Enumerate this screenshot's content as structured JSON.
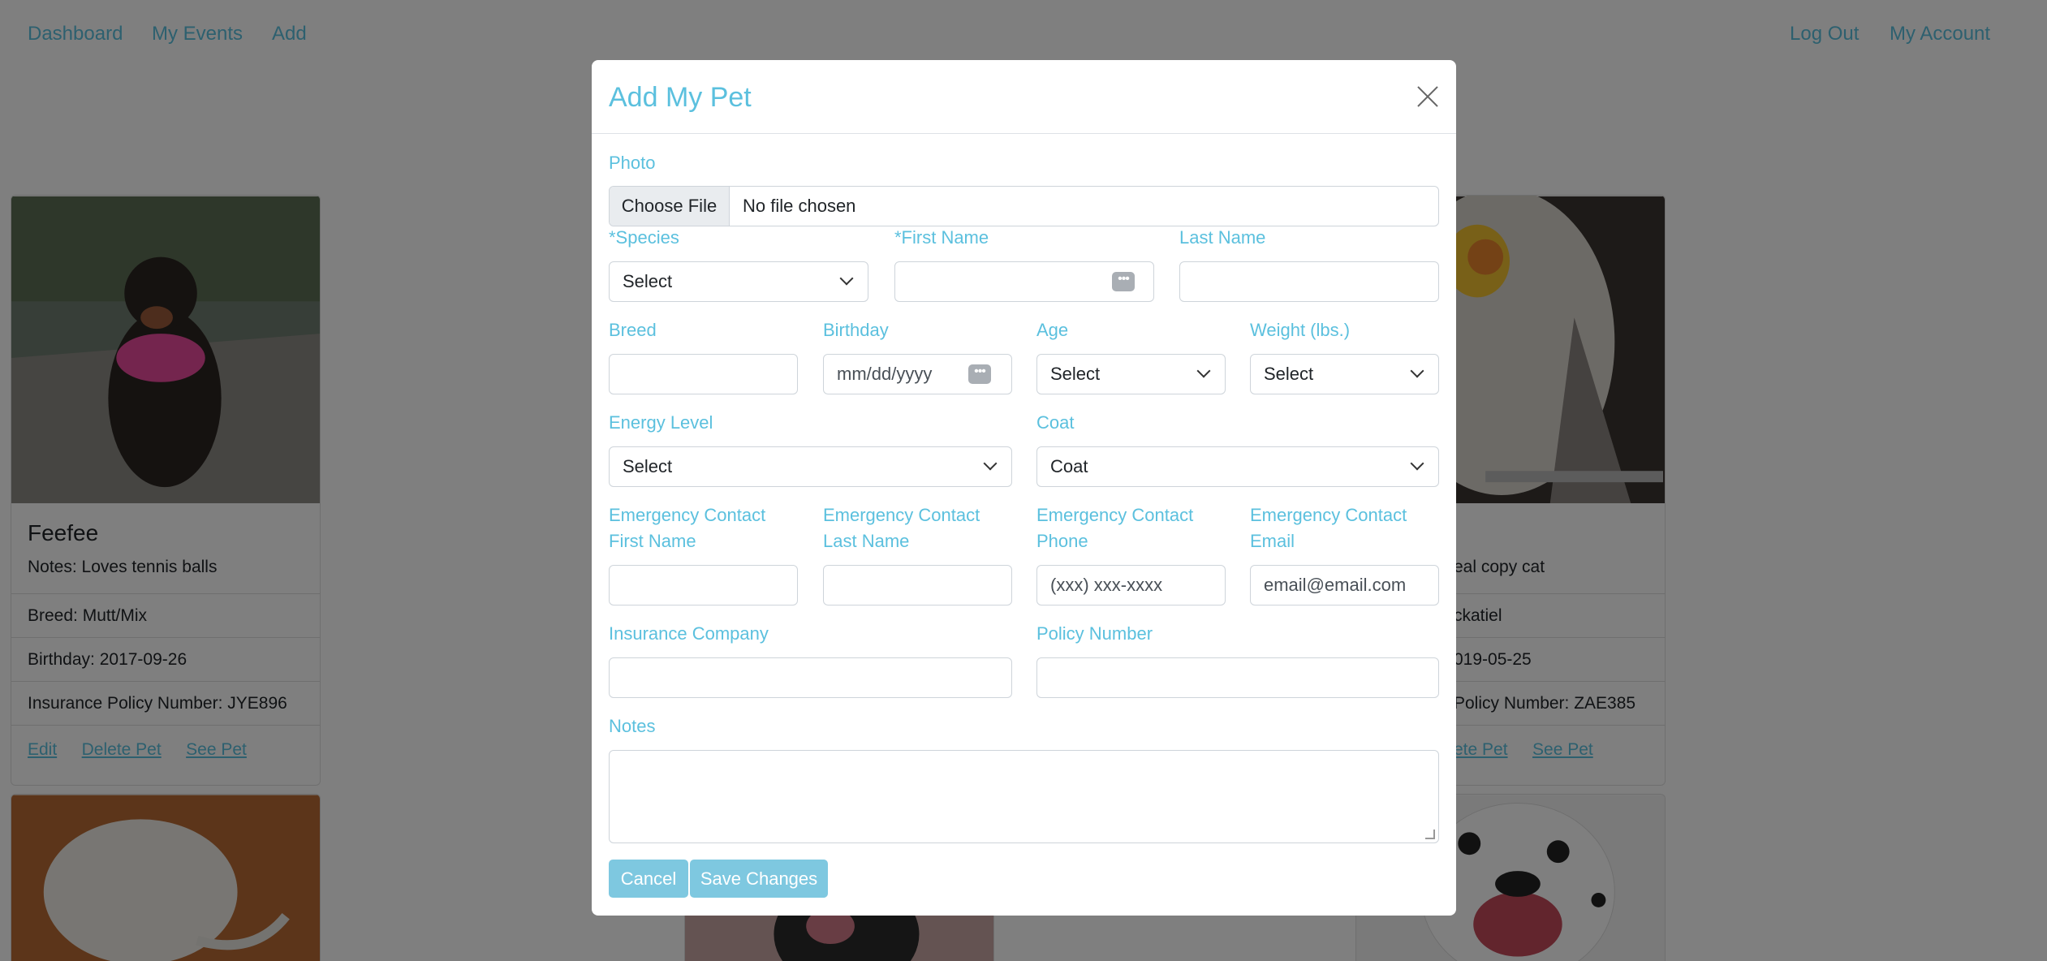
{
  "nav": {
    "left": [
      "Dashboard",
      "My Events",
      "Add"
    ],
    "right": [
      "Log Out",
      "My Account"
    ]
  },
  "cards": {
    "left": {
      "name": "Feefee",
      "notes": "Notes: Loves tennis balls",
      "breed": "Breed: Mutt/Mix",
      "birthday": "Birthday: 2017-09-26",
      "policy": "Insurance Policy Number: JYE896",
      "links": [
        "Edit",
        "Delete Pet",
        "See Pet"
      ]
    },
    "right": {
      "notes": "eal copy cat",
      "breed": "ckatiel",
      "birthday": "019-05-25",
      "policy": "Policy Number: ZAE385",
      "links": [
        "ete Pet",
        "See Pet"
      ]
    }
  },
  "modal": {
    "title": "Add My Pet",
    "photo_label": "Photo",
    "file_button": "Choose File",
    "file_status": "No file chosen",
    "species_label": "*Species",
    "species_value": "Select",
    "first_name_label": "*First Name",
    "last_name_label": "Last Name",
    "breed_label": "Breed",
    "birthday_label": "Birthday",
    "birthday_placeholder": "mm/dd/yyyy",
    "age_label": "Age",
    "age_value": "Select",
    "weight_label": "Weight (lbs.)",
    "weight_value": "Select",
    "energy_label": "Energy Level",
    "energy_value": "Select",
    "coat_label": "Coat",
    "coat_value": "Coat",
    "ec_first_label_1": "Emergency Contact",
    "ec_first_label_2": "First Name",
    "ec_last_label_1": "Emergency Contact",
    "ec_last_label_2": "Last Name",
    "ec_phone_label_1": "Emergency Contact",
    "ec_phone_label_2": "Phone",
    "ec_phone_placeholder": "(xxx) xxx-xxxx",
    "ec_email_label_1": "Emergency Contact",
    "ec_email_label_2": "Email",
    "ec_email_placeholder": "email@email.com",
    "insurance_label": "Insurance Company",
    "policy_label": "Policy Number",
    "notes_label": "Notes",
    "cancel": "Cancel",
    "save": "Save Changes"
  },
  "colors": {
    "accent": "#5bc0de",
    "button": "#7ec8e0",
    "backdrop": "rgba(0,0,0,0.5)"
  },
  "icons": [
    "close-icon",
    "chevron-down-icon",
    "autofill-dots-icon",
    "resize-handle-icon"
  ]
}
